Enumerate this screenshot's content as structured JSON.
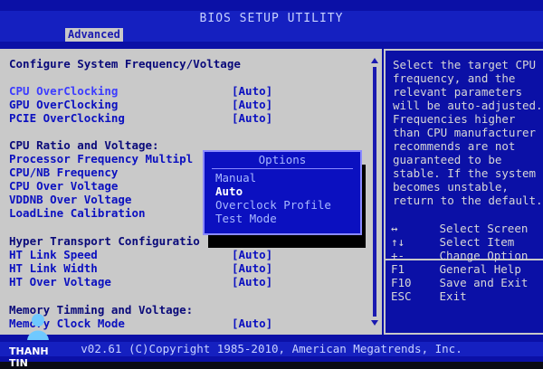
{
  "window": {
    "title": "BIOS SETUP UTILITY"
  },
  "tabs": [
    {
      "label": "Advanced",
      "active": true
    }
  ],
  "main": {
    "section_title": "Configure System Frequency/Voltage",
    "items": [
      {
        "label": "CPU OverClocking",
        "value": "[Auto]",
        "selected": true
      },
      {
        "label": "GPU OverClocking",
        "value": "[Auto]"
      },
      {
        "label": "PCIE OverClocking",
        "value": "[Auto]"
      }
    ],
    "cpu_ratio_heading": "CPU Ratio and Voltage:",
    "cpu_items": [
      {
        "label": "Processor Frequency Multipl",
        "value": ""
      },
      {
        "label": "CPU/NB Frequency",
        "value": ""
      },
      {
        "label": "CPU Over Voltage",
        "value": ""
      },
      {
        "label": "VDDNB Over Voltage",
        "value": ""
      },
      {
        "label": "LoadLine Calibration",
        "value": ""
      }
    ],
    "ht_heading": "Hyper Transport Configuratio",
    "ht_items": [
      {
        "label": "HT Link Speed",
        "value": "[Auto]"
      },
      {
        "label": "HT Link Width",
        "value": "[Auto]"
      },
      {
        "label": "HT Over Voltage",
        "value": "[Auto]"
      }
    ],
    "mem_heading": "Memory Timming and Voltage:",
    "mem_items": [
      {
        "label": "Memory Clock Mode",
        "value": "[Auto]"
      }
    ]
  },
  "popup": {
    "title": "Options",
    "options": [
      {
        "label": "Manual",
        "selected": false
      },
      {
        "label": "Auto",
        "selected": true
      },
      {
        "label": "Overclock Profile",
        "selected": false
      },
      {
        "label": "Test Mode",
        "selected": false
      }
    ]
  },
  "help": {
    "text": "Select the target CPU frequency, and the relevant parameters will be auto-adjusted. Frequencies higher than CPU manufacturer recommends are not guaranteed to be stable. If the system becomes unstable, return to the default.",
    "keys": [
      {
        "key": "↔",
        "desc": "Select Screen"
      },
      {
        "key": "↑↓",
        "desc": "Select Item"
      },
      {
        "key": "+-",
        "desc": "Change Option"
      },
      {
        "key": "F1",
        "desc": "General Help"
      },
      {
        "key": "F10",
        "desc": "Save and Exit"
      },
      {
        "key": "ESC",
        "desc": "Exit"
      }
    ]
  },
  "footer": {
    "text": "v02.61 (C)Copyright 1985-2010, American Megatrends, Inc."
  },
  "watermark": {
    "text": "THANH TIN"
  },
  "colors": {
    "screen_bg": "#0b10a6",
    "panel_bg": "#c9c9c9",
    "text_blue": "#0b10c0",
    "help_text": "#d7d7d7",
    "popup_bg": "#0b10c0"
  }
}
